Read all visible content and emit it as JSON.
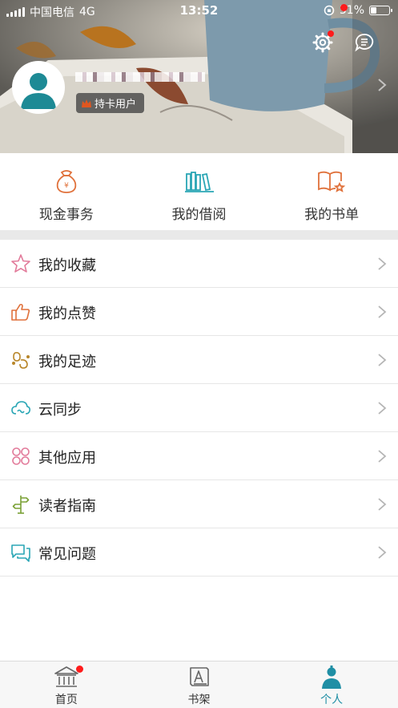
{
  "status_bar": {
    "carrier": "中国电信",
    "network": "4G",
    "time": "13:52",
    "battery_percent_text": "31%",
    "battery_level": 0.31
  },
  "profile": {
    "badge_label": "持卡用户"
  },
  "quick_actions": [
    {
      "label": "现金事务",
      "icon": "money-bag-icon",
      "color": "#e0713b"
    },
    {
      "label": "我的借阅",
      "icon": "books-icon",
      "color": "#2aa6b5"
    },
    {
      "label": "我的书单",
      "icon": "book-star-icon",
      "color": "#e0713b"
    }
  ],
  "menu": [
    {
      "label": "我的收藏",
      "icon": "star-icon",
      "color": "#e27a9a"
    },
    {
      "label": "我的点赞",
      "icon": "thumbs-up-icon",
      "color": "#e0713b"
    },
    {
      "label": "我的足迹",
      "icon": "footprint-icon",
      "color": "#b8862a"
    },
    {
      "label": "云同步",
      "icon": "cloud-sync-icon",
      "color": "#2aa6b5"
    },
    {
      "label": "其他应用",
      "icon": "apps-icon",
      "color": "#e27a9a"
    },
    {
      "label": "读者指南",
      "icon": "signpost-icon",
      "color": "#7aa035"
    },
    {
      "label": "常见问题",
      "icon": "chat-bubbles-icon",
      "color": "#2aa6b5"
    }
  ],
  "tabs": [
    {
      "label": "首页",
      "icon": "library-building-icon",
      "has_dot": true
    },
    {
      "label": "书架",
      "icon": "bookshelf-icon",
      "has_dot": false
    },
    {
      "label": "个人",
      "icon": "person-icon",
      "has_dot": true,
      "active": true
    }
  ],
  "colors": {
    "accent": "#1f8fa5",
    "notification_dot": "#ff1b1b",
    "quick_orange": "#e0713b"
  }
}
